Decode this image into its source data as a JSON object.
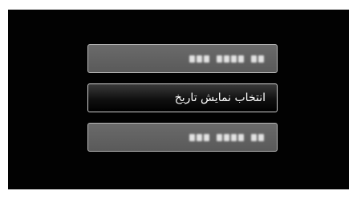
{
  "menu": {
    "items": [
      {
        "label": "",
        "state": "dimmed",
        "obscured": true
      },
      {
        "label": "انتخاب نمایش تاریخ",
        "state": "selected",
        "obscured": false
      },
      {
        "label": "",
        "state": "dimmed",
        "obscured": true
      }
    ]
  },
  "colors": {
    "screen_background": "#020202",
    "dimmed_item": "#5f5f5f",
    "selected_item": "#101010",
    "border": "#c0c0c0",
    "text": "#ffffff"
  }
}
